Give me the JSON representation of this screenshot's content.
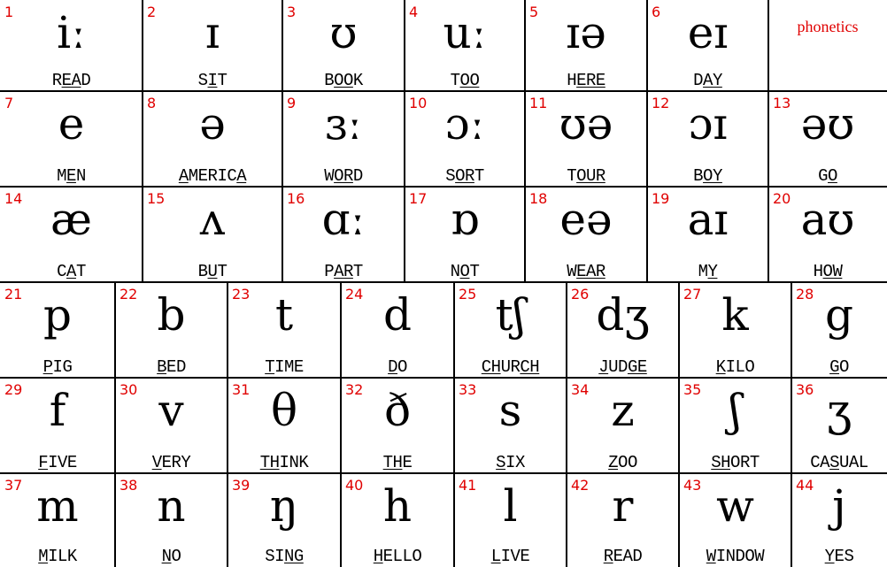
{
  "title": "phonetics",
  "colors": {
    "number": "#e00000",
    "title": "#e00000",
    "grid": "#000000"
  },
  "vowels": [
    {
      "n": "1",
      "symbol": "iː",
      "word": [
        [
          "R",
          0
        ],
        [
          "EA",
          1
        ],
        [
          "D",
          0
        ]
      ]
    },
    {
      "n": "2",
      "symbol": "ɪ",
      "word": [
        [
          "S",
          0
        ],
        [
          "I",
          1
        ],
        [
          "T",
          0
        ]
      ]
    },
    {
      "n": "3",
      "symbol": "ʊ",
      "word": [
        [
          "B",
          0
        ],
        [
          "OO",
          1
        ],
        [
          "K",
          0
        ]
      ]
    },
    {
      "n": "4",
      "symbol": "uː",
      "word": [
        [
          "T",
          0
        ],
        [
          "OO",
          1
        ]
      ]
    },
    {
      "n": "5",
      "symbol": "ɪə",
      "word": [
        [
          "H",
          0
        ],
        [
          "ERE",
          1
        ]
      ]
    },
    {
      "n": "6",
      "symbol": "eɪ",
      "word": [
        [
          "D",
          0
        ],
        [
          "AY",
          1
        ]
      ]
    },
    {
      "n": "7",
      "symbol": "e",
      "word": [
        [
          "M",
          0
        ],
        [
          "E",
          1
        ],
        [
          "N",
          0
        ]
      ]
    },
    {
      "n": "8",
      "symbol": "ə",
      "word": [
        [
          "A",
          1
        ],
        [
          "MERIC",
          0
        ],
        [
          "A",
          1
        ]
      ]
    },
    {
      "n": "9",
      "symbol": "ɜː",
      "word": [
        [
          "W",
          0
        ],
        [
          "OR",
          1
        ],
        [
          "D",
          0
        ]
      ]
    },
    {
      "n": "10",
      "symbol": "ɔː",
      "word": [
        [
          "S",
          0
        ],
        [
          "OR",
          1
        ],
        [
          "T",
          0
        ]
      ]
    },
    {
      "n": "11",
      "symbol": "ʊə",
      "word": [
        [
          "T",
          0
        ],
        [
          "OUR",
          1
        ]
      ]
    },
    {
      "n": "12",
      "symbol": "ɔɪ",
      "word": [
        [
          "B",
          0
        ],
        [
          "OY",
          1
        ]
      ]
    },
    {
      "n": "13",
      "symbol": "əʊ",
      "word": [
        [
          "G",
          0
        ],
        [
          "O",
          1
        ]
      ]
    },
    {
      "n": "14",
      "symbol": "æ",
      "word": [
        [
          "C",
          0
        ],
        [
          "A",
          1
        ],
        [
          "T",
          0
        ]
      ]
    },
    {
      "n": "15",
      "symbol": "ʌ",
      "word": [
        [
          "B",
          0
        ],
        [
          "U",
          1
        ],
        [
          "T",
          0
        ]
      ]
    },
    {
      "n": "16",
      "symbol": "ɑː",
      "word": [
        [
          "P",
          0
        ],
        [
          "AR",
          1
        ],
        [
          "T",
          0
        ]
      ]
    },
    {
      "n": "17",
      "symbol": "ɒ",
      "word": [
        [
          "N",
          0
        ],
        [
          "O",
          1
        ],
        [
          "T",
          0
        ]
      ]
    },
    {
      "n": "18",
      "symbol": "eə",
      "word": [
        [
          "W",
          0
        ],
        [
          "EAR",
          1
        ]
      ]
    },
    {
      "n": "19",
      "symbol": "aɪ",
      "word": [
        [
          "M",
          0
        ],
        [
          "Y",
          1
        ]
      ]
    },
    {
      "n": "20",
      "symbol": "aʊ",
      "word": [
        [
          "H",
          0
        ],
        [
          "OW",
          1
        ]
      ]
    }
  ],
  "consonants": [
    {
      "n": "21",
      "symbol": "p",
      "word": [
        [
          "P",
          1
        ],
        [
          "IG",
          0
        ]
      ]
    },
    {
      "n": "22",
      "symbol": "b",
      "word": [
        [
          "B",
          1
        ],
        [
          "ED",
          0
        ]
      ]
    },
    {
      "n": "23",
      "symbol": "t",
      "word": [
        [
          "T",
          1
        ],
        [
          "IME",
          0
        ]
      ]
    },
    {
      "n": "24",
      "symbol": "d",
      "word": [
        [
          "D",
          1
        ],
        [
          "O",
          0
        ]
      ]
    },
    {
      "n": "25",
      "symbol": "tʃ",
      "word": [
        [
          "CH",
          1
        ],
        [
          "UR",
          0
        ],
        [
          "CH",
          1
        ]
      ]
    },
    {
      "n": "26",
      "symbol": "dʒ",
      "word": [
        [
          "J",
          1
        ],
        [
          "UD",
          0
        ],
        [
          "GE",
          1
        ]
      ]
    },
    {
      "n": "27",
      "symbol": "k",
      "word": [
        [
          "K",
          1
        ],
        [
          "ILO",
          0
        ]
      ]
    },
    {
      "n": "28",
      "symbol": "g",
      "word": [
        [
          "G",
          1
        ],
        [
          "O",
          0
        ]
      ]
    },
    {
      "n": "29",
      "symbol": "f",
      "word": [
        [
          "F",
          1
        ],
        [
          "IVE",
          0
        ]
      ]
    },
    {
      "n": "30",
      "symbol": "v",
      "word": [
        [
          "V",
          1
        ],
        [
          "ERY",
          0
        ]
      ]
    },
    {
      "n": "31",
      "symbol": "θ",
      "word": [
        [
          "TH",
          1
        ],
        [
          "INK",
          0
        ]
      ]
    },
    {
      "n": "32",
      "symbol": "ð",
      "word": [
        [
          "TH",
          1
        ],
        [
          "E",
          0
        ]
      ]
    },
    {
      "n": "33",
      "symbol": "s",
      "word": [
        [
          "S",
          1
        ],
        [
          "IX",
          0
        ]
      ]
    },
    {
      "n": "34",
      "symbol": "z",
      "word": [
        [
          "Z",
          1
        ],
        [
          "OO",
          0
        ]
      ]
    },
    {
      "n": "35",
      "symbol": "ʃ",
      "word": [
        [
          "SH",
          1
        ],
        [
          "ORT",
          0
        ]
      ]
    },
    {
      "n": "36",
      "symbol": "ʒ",
      "word": [
        [
          "CA",
          0
        ],
        [
          "S",
          1
        ],
        [
          "UAL",
          0
        ]
      ]
    },
    {
      "n": "37",
      "symbol": "m",
      "word": [
        [
          "M",
          1
        ],
        [
          "ILK",
          0
        ]
      ]
    },
    {
      "n": "38",
      "symbol": "n",
      "word": [
        [
          "N",
          1
        ],
        [
          "O",
          0
        ]
      ]
    },
    {
      "n": "39",
      "symbol": "ŋ",
      "word": [
        [
          "SI",
          0
        ],
        [
          "NG",
          1
        ]
      ]
    },
    {
      "n": "40",
      "symbol": "h",
      "word": [
        [
          "H",
          1
        ],
        [
          "ELLO",
          0
        ]
      ]
    },
    {
      "n": "41",
      "symbol": "l",
      "word": [
        [
          "L",
          1
        ],
        [
          "IVE",
          0
        ]
      ]
    },
    {
      "n": "42",
      "symbol": "r",
      "word": [
        [
          "R",
          1
        ],
        [
          "EAD",
          0
        ]
      ]
    },
    {
      "n": "43",
      "symbol": "w",
      "word": [
        [
          "W",
          1
        ],
        [
          "INDOW",
          0
        ]
      ]
    },
    {
      "n": "44",
      "symbol": "j",
      "word": [
        [
          "Y",
          1
        ],
        [
          "ES",
          0
        ]
      ]
    }
  ]
}
